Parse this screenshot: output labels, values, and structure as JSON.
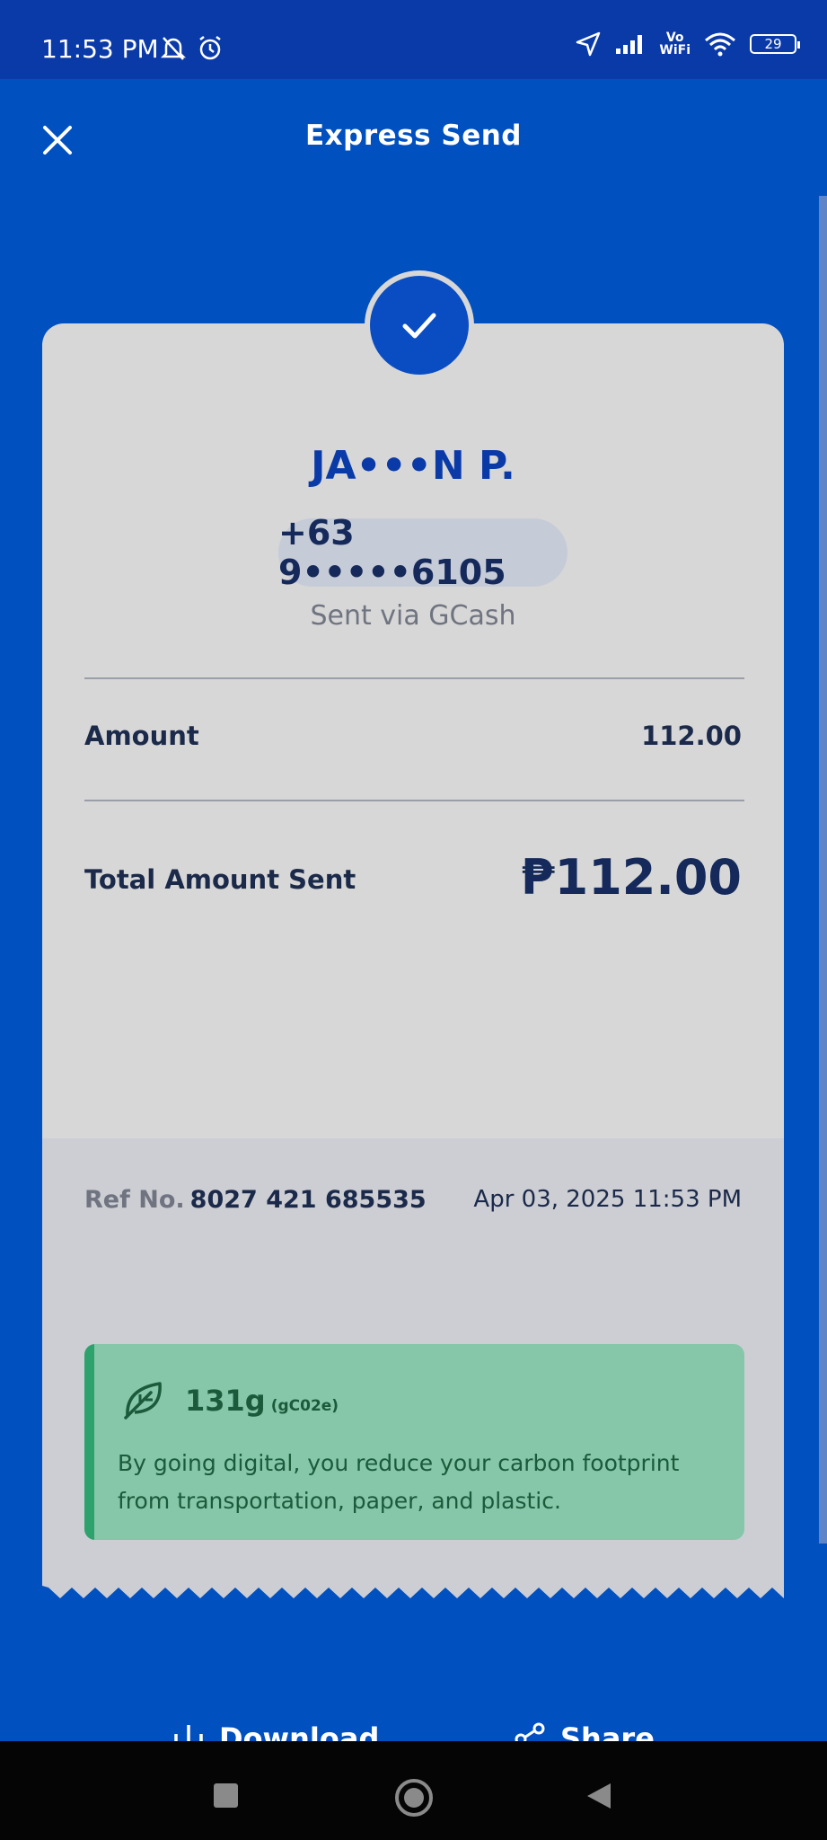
{
  "status_bar": {
    "time": "11:53 PM",
    "vowifi_top": "Vo",
    "vowifi_bottom": "WiFi",
    "battery": "29"
  },
  "header": {
    "title": "Express Send"
  },
  "receipt": {
    "recipient_name": "JA•••N P.",
    "phone": "+63 9•••••6105",
    "sent_via": "Sent via GCash",
    "amount_label": "Amount",
    "amount_value": "112.00",
    "total_label": "Total Amount Sent",
    "total_value": "₱112.00",
    "ref_label": "Ref No.",
    "ref_value": "8027 421 685535",
    "date": "Apr 03, 2025 11:53 PM"
  },
  "eco": {
    "value": "131g",
    "unit": "(gC02e)",
    "text": "By going digital, you reduce your carbon footprint from transportation, paper, and plastic."
  },
  "actions": {
    "download_label": "Download",
    "share_label": "Share"
  },
  "colors": {
    "background": "#0050c0",
    "accent": "#0a3aa8",
    "eco_green": "#86c6a9"
  }
}
